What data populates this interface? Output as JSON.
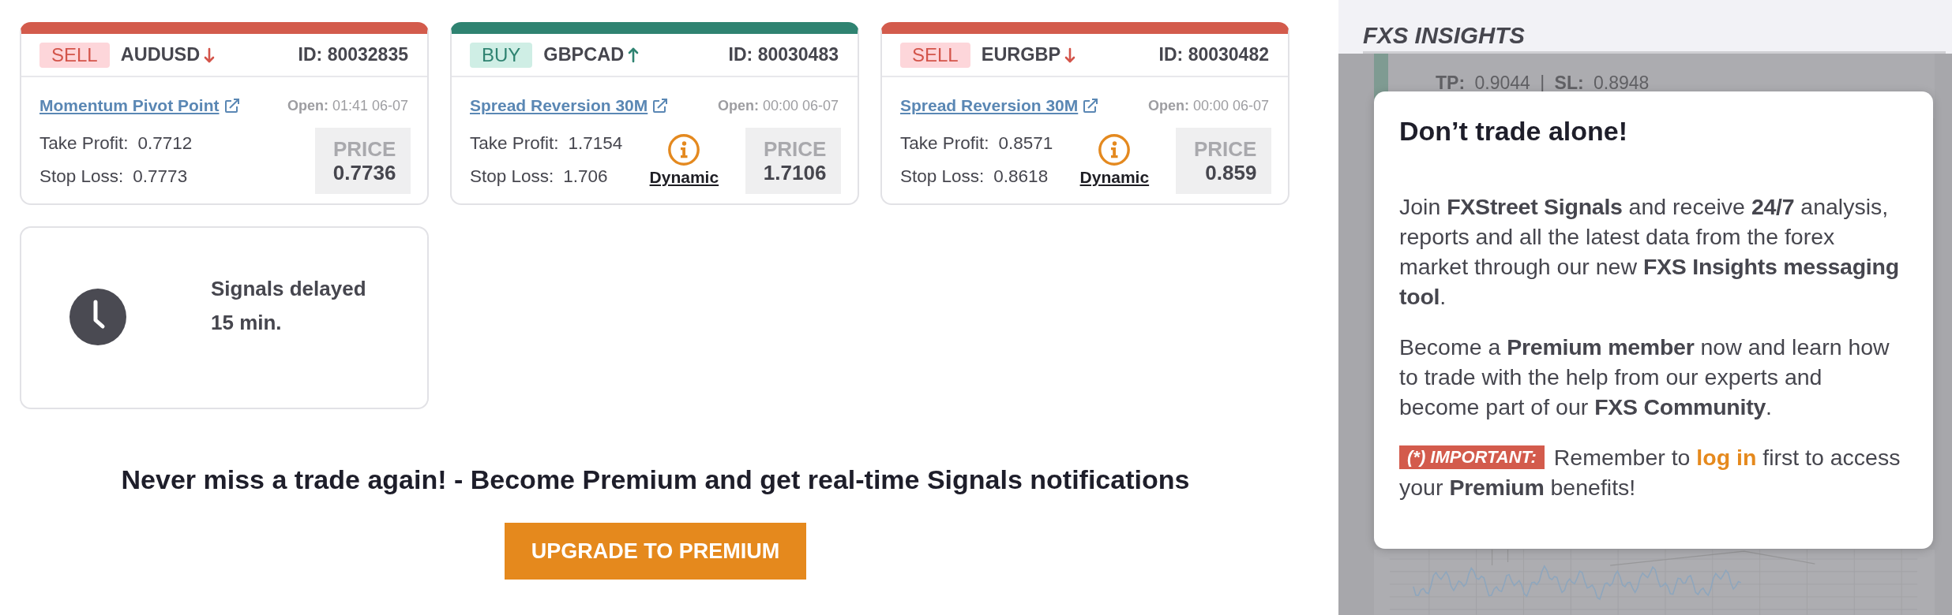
{
  "signals": [
    {
      "kind": "sell",
      "side": "SELL",
      "pair": "AUDUSD",
      "id": "ID: 80032835",
      "strategy": "Momentum Pivot Point",
      "opened": "**Open:** 01:41 06-07",
      "take_profit": {
        "label": "Take Profit:",
        "value": "0.7712"
      },
      "stop_loss": {
        "label": "Stop Loss:",
        "value": "0.7773"
      },
      "price": {
        "label": "PRICE",
        "value": "0.7736"
      }
    },
    {
      "kind": "buy",
      "side": "BUY",
      "pair": "GBPCAD",
      "id": "ID: 80030483",
      "strategy": "Spread Reversion 30M",
      "opened": "**Open:** 00:00 06-07",
      "take_profit": {
        "label": "Take Profit:",
        "value": "1.7154"
      },
      "stop_loss": {
        "label": "Stop Loss:",
        "value": "1.706"
      },
      "dynamic_label": "Dynamic",
      "price": {
        "label": "PRICE",
        "value": "1.7106"
      }
    },
    {
      "kind": "sell",
      "side": "SELL",
      "pair": "EURGBP",
      "id": "ID: 80030482",
      "strategy": "Spread Reversion 30M",
      "opened": "**Open:** 00:00 06-07",
      "take_profit": {
        "label": "Take Profit:",
        "value": "0.8571"
      },
      "stop_loss": {
        "label": "Stop Loss:",
        "value": "0.8618"
      },
      "dynamic_label": "Dynamic",
      "price": {
        "label": "PRICE",
        "value": "0.859"
      }
    }
  ],
  "delay_notice": {
    "text": "Signals delayed 15 min."
  },
  "promo": {
    "headline": "Never miss a trade again! - Become Premium and get real-time Signals notifications",
    "button": "UPGRADE TO PREMIUM"
  },
  "insights_panel": {
    "title": "FXS INSIGHTS",
    "background_update": "**TP:** 0.9044 | **SL:** 0.8948",
    "modal": {
      "title": "Don’t trade alone!",
      "paragraphs": [
        "Join **FXStreet Signals** and receive **24/7** analysis, reports and all the latest data from the forex market through our new **FXS Insights messaging tool**.",
        "Become a **Premium member** now and learn how to trade with the help from our experts and become part of our **FXS Community**."
      ],
      "notice": {
        "badge": "(*) IMPORTANT:",
        "before_link": "Remember to",
        "link": "log in",
        "after_link": "first to access your **Premium** benefits!"
      }
    }
  }
}
